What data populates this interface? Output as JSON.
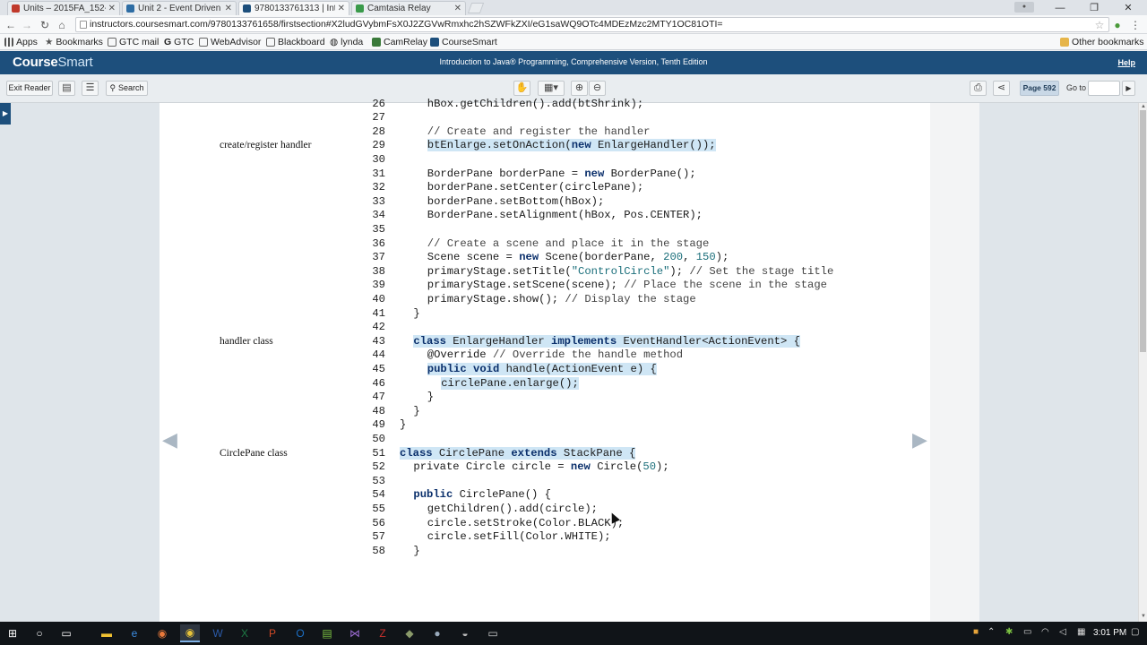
{
  "browser": {
    "tabs": [
      {
        "label": "Units – 2015FA_152-",
        "color": "#c0392b"
      },
      {
        "label": "Unit 2 - Event Driven",
        "color": "#2e6da4"
      },
      {
        "label": "9780133761313 | Intr",
        "color": "#1d4f7c"
      },
      {
        "label": "Camtasia Relay",
        "color": "#3a9a4a"
      }
    ],
    "url": "instructors.coursesmart.com/9780133761658/firstsection#X2ludGVybmFsX0J2ZGVwRmxhc2hSZWFkZXI/eG1saWQ9OTc4MDEzMzc2MTY1OC81OTI=",
    "bookmarks": [
      {
        "label": "Apps",
        "icon": "apps-icon"
      },
      {
        "label": "Bookmarks",
        "icon": "star-icon"
      },
      {
        "label": "GTC mail",
        "icon": "mail-icon"
      },
      {
        "label": "GTC",
        "icon": "g-icon"
      },
      {
        "label": "WebAdvisor",
        "icon": "webadvisor-icon"
      },
      {
        "label": "Blackboard",
        "icon": "blackboard-icon"
      },
      {
        "label": "lynda",
        "icon": "lynda-icon"
      },
      {
        "label": "CamRelay",
        "icon": "camrelay-icon"
      },
      {
        "label": "CourseSmart",
        "icon": "coursesmart-icon"
      }
    ],
    "other_bookmarks": "Other bookmarks"
  },
  "header": {
    "logo_course": "Course",
    "logo_smart": "Smart",
    "book_title": "Introduction to Java® Programming, Comprehensive Version, Tenth Edition",
    "help": "Help"
  },
  "toolbar": {
    "exit_reader": "Exit Reader",
    "search": "Search",
    "page_indicator": "Page 592",
    "goto_label": "Go to"
  },
  "margin_notes": [
    {
      "text": "create/register handler",
      "line": 29
    },
    {
      "text": "handler class",
      "line": 43
    },
    {
      "text": "CirclePane class",
      "line": 51
    }
  ],
  "code_lines": [
    {
      "n": "26",
      "indent": 2,
      "text": "hBox.getChildren().add(btShrink);"
    },
    {
      "n": "27",
      "indent": 0,
      "text": ""
    },
    {
      "n": "28",
      "indent": 2,
      "text": "// Create and register the handler"
    },
    {
      "n": "29",
      "indent": 2,
      "text": "btEnlarge.setOnAction(new EnlargeHandler());"
    },
    {
      "n": "30",
      "indent": 0,
      "text": ""
    },
    {
      "n": "31",
      "indent": 2,
      "text": "BorderPane borderPane = new BorderPane();"
    },
    {
      "n": "32",
      "indent": 2,
      "text": "borderPane.setCenter(circlePane);"
    },
    {
      "n": "33",
      "indent": 2,
      "text": "borderPane.setBottom(hBox);"
    },
    {
      "n": "34",
      "indent": 2,
      "text": "BorderPane.setAlignment(hBox, Pos.CENTER);"
    },
    {
      "n": "35",
      "indent": 0,
      "text": ""
    },
    {
      "n": "36",
      "indent": 2,
      "text": "// Create a scene and place it in the stage"
    },
    {
      "n": "37",
      "indent": 2,
      "text": "Scene scene = new Scene(borderPane, 200, 150);"
    },
    {
      "n": "38",
      "indent": 2,
      "text": "primaryStage.setTitle(\"ControlCircle\"); // Set the stage title"
    },
    {
      "n": "39",
      "indent": 2,
      "text": "primaryStage.setScene(scene); // Place the scene in the stage"
    },
    {
      "n": "40",
      "indent": 2,
      "text": "primaryStage.show(); // Display the stage"
    },
    {
      "n": "41",
      "indent": 1,
      "text": "}"
    },
    {
      "n": "42",
      "indent": 0,
      "text": ""
    },
    {
      "n": "43",
      "indent": 1,
      "text": "class EnlargeHandler implements EventHandler<ActionEvent> {"
    },
    {
      "n": "44",
      "indent": 2,
      "text": "@Override // Override the handle method"
    },
    {
      "n": "45",
      "indent": 2,
      "text": "public void handle(ActionEvent e) {"
    },
    {
      "n": "46",
      "indent": 3,
      "text": "circlePane.enlarge();"
    },
    {
      "n": "47",
      "indent": 2,
      "text": "}"
    },
    {
      "n": "48",
      "indent": 1,
      "text": "}"
    },
    {
      "n": "49",
      "indent": 0,
      "text": "}"
    },
    {
      "n": "50",
      "indent": 0,
      "text": ""
    },
    {
      "n": "51",
      "indent": 0,
      "text": "class CirclePane extends StackPane {"
    },
    {
      "n": "52",
      "indent": 1,
      "text": "private Circle circle = new Circle(50);"
    },
    {
      "n": "53",
      "indent": 0,
      "text": ""
    },
    {
      "n": "54",
      "indent": 1,
      "text": "public CirclePane() {"
    },
    {
      "n": "55",
      "indent": 2,
      "text": "getChildren().add(circle);"
    },
    {
      "n": "56",
      "indent": 2,
      "text": "circle.setStroke(Color.BLACK);"
    },
    {
      "n": "57",
      "indent": 2,
      "text": "circle.setFill(Color.WHITE);"
    },
    {
      "n": "58",
      "indent": 1,
      "text": "}"
    }
  ],
  "highlighted_lines": [
    "29",
    "43",
    "45",
    "46",
    "51"
  ],
  "taskbar": {
    "clock": "3:01 PM"
  },
  "colors": {
    "header_bg": "#1d4f7c",
    "highlight": "#cfe6f5"
  }
}
